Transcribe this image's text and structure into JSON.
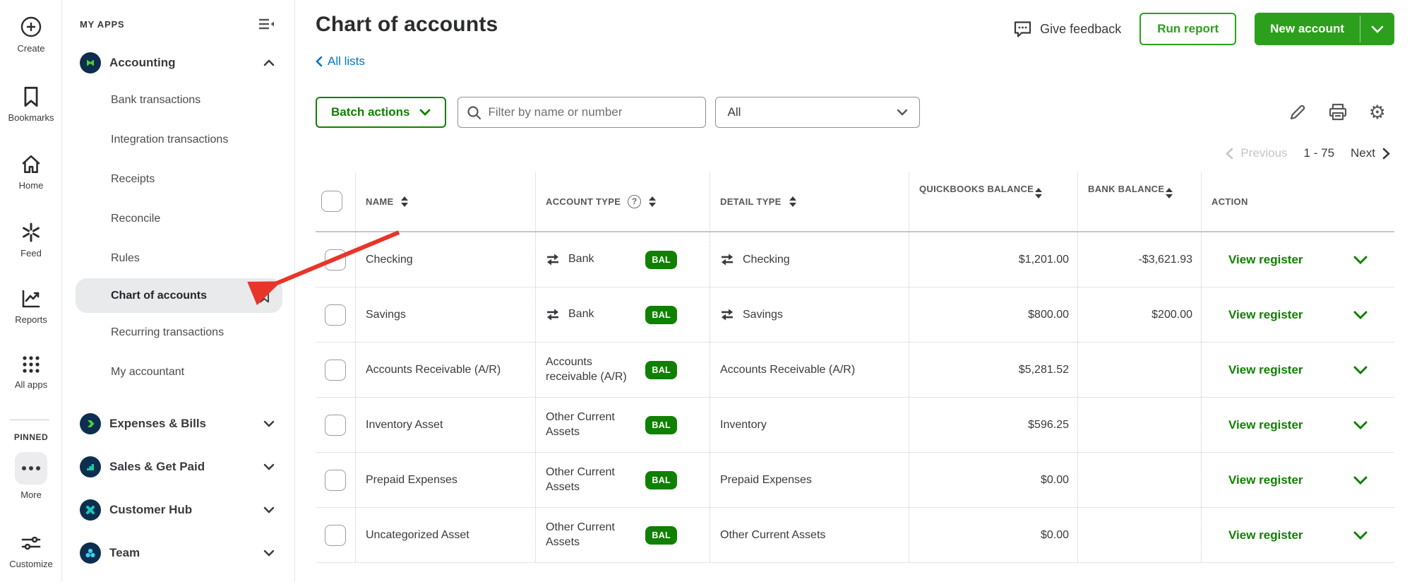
{
  "left_rail": {
    "items": [
      "Create",
      "Bookmarks",
      "Home",
      "Feed",
      "Reports",
      "All apps"
    ],
    "pinned_label": "PINNED",
    "more_label": "More",
    "customize_label": "Customize"
  },
  "sidebar": {
    "header": "MY APPS",
    "accounting": {
      "label": "Accounting",
      "items": [
        "Bank transactions",
        "Integration transactions",
        "Receipts",
        "Reconcile",
        "Rules",
        "Chart of accounts",
        "Recurring transactions",
        "My accountant"
      ],
      "active_item": "Chart of accounts"
    },
    "groups": [
      "Expenses & Bills",
      "Sales & Get Paid",
      "Customer Hub",
      "Team"
    ]
  },
  "header": {
    "title": "Chart of accounts",
    "back_link": "All lists",
    "give_feedback": "Give feedback",
    "run_report": "Run report",
    "new_account": "New account"
  },
  "toolbar": {
    "batch_actions": "Batch actions",
    "filter_placeholder": "Filter by name or number",
    "type_filter_value": "All"
  },
  "pagination": {
    "previous": "Previous",
    "range": "1 - 75",
    "next": "Next"
  },
  "table": {
    "columns": [
      "NAME",
      "ACCOUNT TYPE",
      "DETAIL TYPE",
      "QUICKBOOKS BALANCE",
      "BANK BALANCE",
      "ACTION"
    ],
    "badge": "BAL",
    "action_label": "View register",
    "rows": [
      {
        "name": "Checking",
        "account_type": "Bank",
        "detail_type": "Checking",
        "qb_balance": "$1,201.00",
        "bank_balance": "-$3,621.93"
      },
      {
        "name": "Savings",
        "account_type": "Bank",
        "detail_type": "Savings",
        "qb_balance": "$800.00",
        "bank_balance": "$200.00"
      },
      {
        "name": "Accounts Receivable (A/R)",
        "account_type": "Accounts receivable (A/R)",
        "detail_type": "Accounts Receivable (A/R)",
        "qb_balance": "$5,281.52",
        "bank_balance": ""
      },
      {
        "name": "Inventory Asset",
        "account_type": "Other Current Assets",
        "detail_type": "Inventory",
        "qb_balance": "$596.25",
        "bank_balance": ""
      },
      {
        "name": "Prepaid Expenses",
        "account_type": "Other Current Assets",
        "detail_type": "Prepaid Expenses",
        "qb_balance": "$0.00",
        "bank_balance": ""
      },
      {
        "name": "Uncategorized Asset",
        "account_type": "Other Current Assets",
        "detail_type": "Other Current Assets",
        "qb_balance": "$0.00",
        "bank_balance": ""
      }
    ]
  },
  "colors": {
    "primary_green": "#2ca01c",
    "dark_green": "#108000",
    "link_blue": "#0077c5",
    "arrow_red": "#e8352a",
    "navy_icon": "#0d2e4e"
  }
}
